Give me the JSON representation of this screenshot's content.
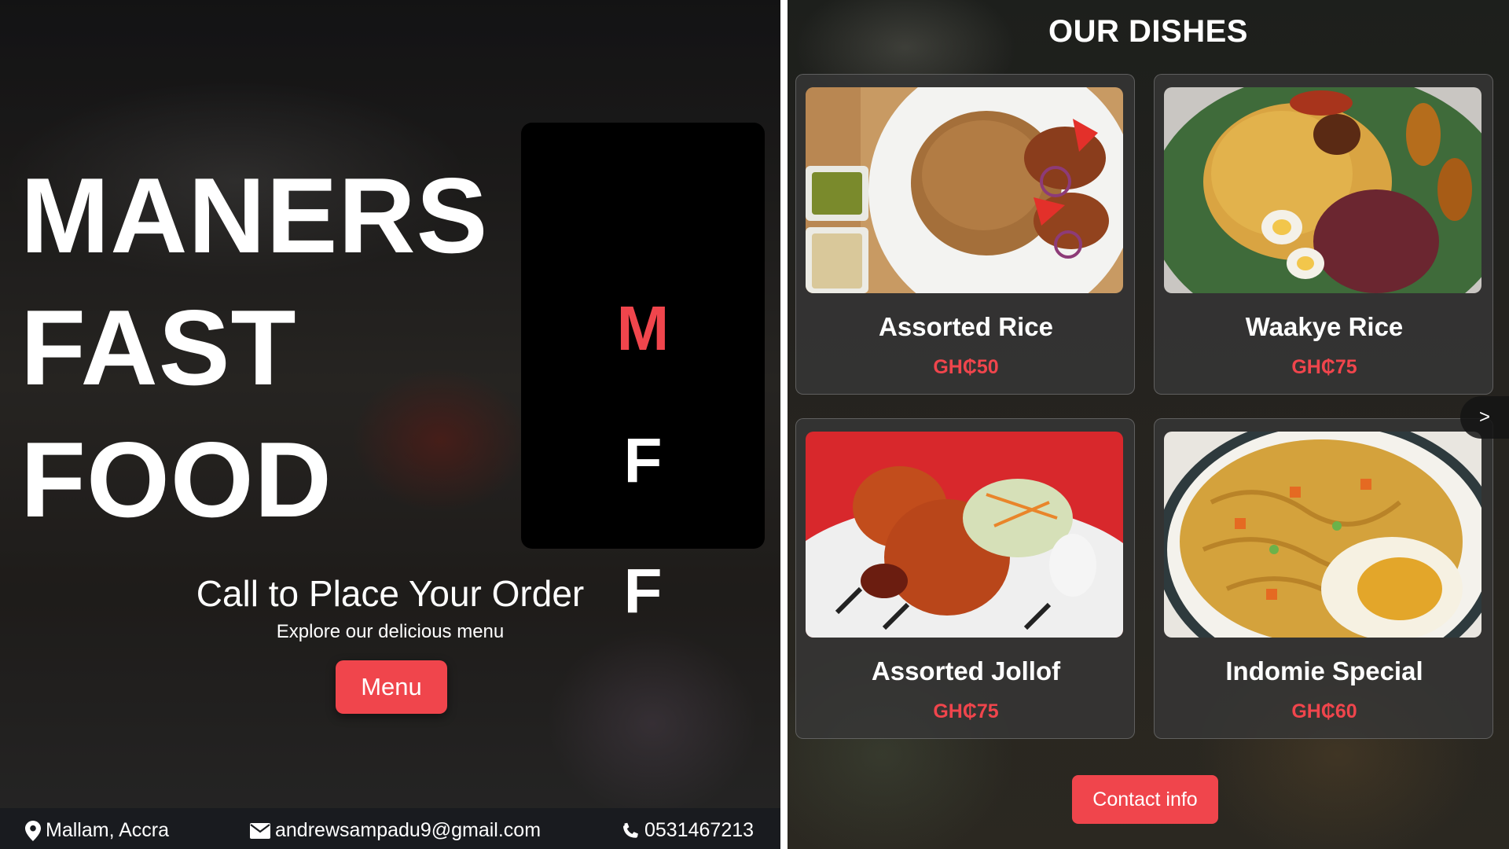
{
  "hero": {
    "title_lines": [
      "MANERS",
      "FAST",
      "FOOD"
    ],
    "monogram": [
      "M",
      "F",
      "F"
    ],
    "cta_heading": "Call to Place Your Order",
    "cta_sub": "Explore our delicious menu",
    "menu_button": "Menu"
  },
  "footer": {
    "location": "Mallam, Accra",
    "email": "andrewsampadu9@gmail.com",
    "phone": "0531467213"
  },
  "dishes_section": {
    "title": "OUR DISHES",
    "next_label": ">",
    "items": [
      {
        "name": "Assorted Rice",
        "price": "GH₵50"
      },
      {
        "name": "Waakye Rice",
        "price": "GH₵75"
      },
      {
        "name": "Assorted Jollof",
        "price": "GH₵75"
      },
      {
        "name": "Indomie Special",
        "price": "GH₵60"
      }
    ],
    "contact_button": "Contact info"
  },
  "colors": {
    "accent": "#f0454c",
    "footer_bg": "#191b1f",
    "monogram_bg": "#000000"
  },
  "icons": {
    "location": "map-pin-icon",
    "email": "envelope-icon",
    "phone": "phone-icon"
  }
}
